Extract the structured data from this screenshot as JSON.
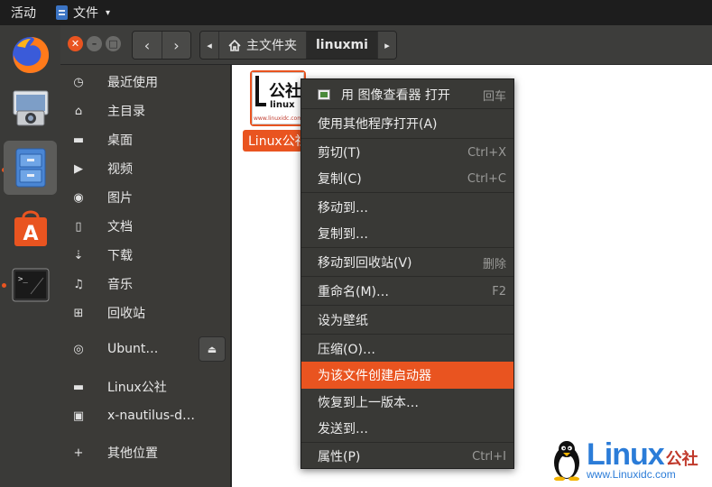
{
  "topbar": {
    "activities": "活动",
    "app_name": "文件",
    "app_caret": "▾"
  },
  "dock": {
    "items": [
      {
        "name": "firefox",
        "icon": "firefox-icon",
        "active": false,
        "running": false
      },
      {
        "name": "screenshot",
        "icon": "camera-icon",
        "active": false,
        "running": false
      },
      {
        "name": "files",
        "icon": "file-cabinet-icon",
        "active": true,
        "running": true
      },
      {
        "name": "software",
        "icon": "shopping-bag-icon",
        "active": false,
        "running": false
      },
      {
        "name": "terminal",
        "icon": "terminal-icon",
        "active": false,
        "running": true
      }
    ]
  },
  "header": {
    "window_buttons": {
      "close": "✕",
      "minimize": "–",
      "maximize": "□"
    },
    "nav_back": "‹",
    "nav_forward": "›",
    "path_left_arrow": "◂",
    "path_home": "主文件夹",
    "path_current": "linuxmi",
    "path_right_arrow": "▸"
  },
  "sidebar": {
    "items": [
      {
        "label": "最近使用",
        "icon": "clock-icon",
        "glyph": "◷"
      },
      {
        "label": "主目录",
        "icon": "home-icon",
        "glyph": "⌂"
      },
      {
        "label": "桌面",
        "icon": "folder-icon",
        "glyph": "▬"
      },
      {
        "label": "视频",
        "icon": "video-icon",
        "glyph": "▶"
      },
      {
        "label": "图片",
        "icon": "camera-icon",
        "glyph": "◉"
      },
      {
        "label": "文档",
        "icon": "document-icon",
        "glyph": "▯"
      },
      {
        "label": "下载",
        "icon": "download-icon",
        "glyph": "⇣"
      },
      {
        "label": "音乐",
        "icon": "music-icon",
        "glyph": "♫"
      },
      {
        "label": "回收站",
        "icon": "trash-icon",
        "glyph": "⊞"
      }
    ],
    "device": {
      "label": "Ubunt…",
      "icon": "disc-icon",
      "glyph": "◎",
      "eject": "⏏"
    },
    "bookmarks": [
      {
        "label": "Linux公社",
        "icon": "folder-icon",
        "glyph": "▬"
      },
      {
        "label": "x-nautilus-d…",
        "icon": "network-icon",
        "glyph": "▣"
      }
    ],
    "other": {
      "label": "其他位置",
      "icon": "plus-icon",
      "glyph": "+"
    }
  },
  "content": {
    "file": {
      "label": "Linux公社",
      "thumb_text": "公社",
      "thumb_sub": "linux",
      "thumb_url": "www.linuxidc.com"
    }
  },
  "context_menu": {
    "items": [
      {
        "label": "用 图像查看器 打开",
        "accel": "回车",
        "has_icon": true
      },
      {
        "label": "使用其他程序打开(A)",
        "accel": ""
      },
      {
        "label": "剪切(T)",
        "accel": "Ctrl+X"
      },
      {
        "label": "复制(C)",
        "accel": "Ctrl+C"
      },
      {
        "label": "移动到…",
        "accel": ""
      },
      {
        "label": "复制到…",
        "accel": ""
      },
      {
        "label": "移动到回收站(V)",
        "accel": "删除"
      },
      {
        "label": "重命名(M)…",
        "accel": "F2"
      },
      {
        "label": "设为壁纸",
        "accel": ""
      },
      {
        "label": "压缩(O)…",
        "accel": ""
      },
      {
        "label": "为该文件创建启动器",
        "accel": "",
        "highlighted": true
      },
      {
        "label": "恢复到上一版本…",
        "accel": ""
      },
      {
        "label": "发送到…",
        "accel": ""
      },
      {
        "label": "属性(P)",
        "accel": "Ctrl+I"
      }
    ]
  },
  "watermark": {
    "brand": "Linux",
    "brand_cn": "公社",
    "url": "www.Linuxidc.com"
  },
  "colors": {
    "accent": "#e95420",
    "dock_bg": "#3a3a38",
    "menu_bg": "#393936",
    "watermark_blue": "#2b7cd8"
  }
}
